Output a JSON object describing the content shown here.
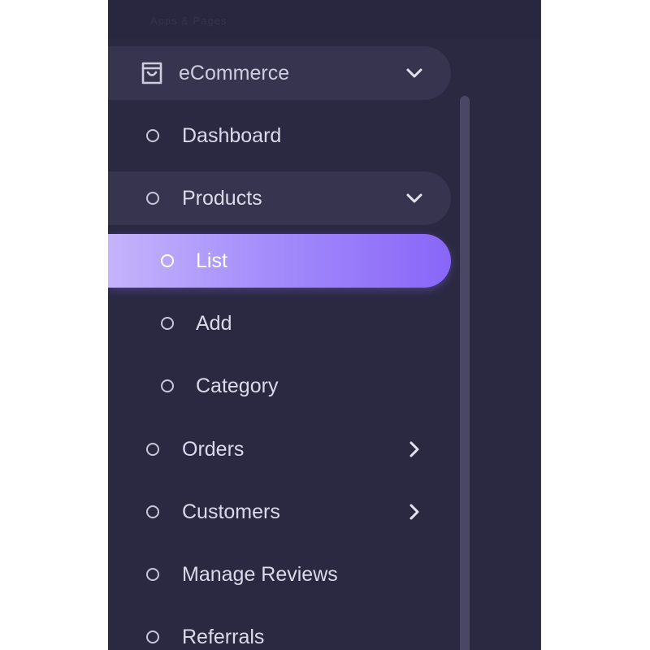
{
  "header": {
    "faded_text": "Apps & Pages"
  },
  "menu": {
    "ecommerce": {
      "label": "eCommerce",
      "icon": "shopping-bag-icon",
      "expanded": true
    },
    "dashboard": {
      "label": "Dashboard"
    },
    "products": {
      "label": "Products",
      "expanded": true
    },
    "products_sub": {
      "list": {
        "label": "List",
        "active": true
      },
      "add": {
        "label": "Add"
      },
      "category": {
        "label": "Category"
      }
    },
    "orders": {
      "label": "Orders",
      "has_children": true
    },
    "customers": {
      "label": "Customers",
      "has_children": true
    },
    "manage_reviews": {
      "label": "Manage Reviews"
    },
    "referrals": {
      "label": "Referrals"
    }
  },
  "colors": {
    "sidebar_bg": "#2b2942",
    "pill_bg": "#37344f",
    "active_gradient_start": "#c5b4fb",
    "active_gradient_end": "#8866f8",
    "text": "#dcd9ea",
    "active_text": "#ffffff"
  }
}
